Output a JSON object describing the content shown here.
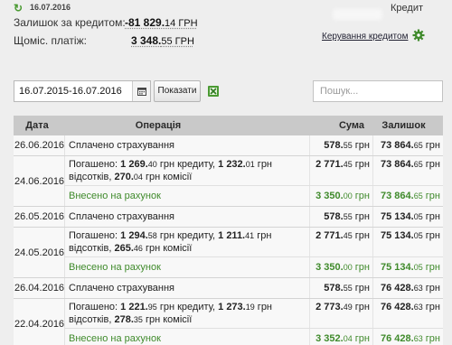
{
  "header": {
    "date": "16.07.2016",
    "product": "Кредит",
    "balance_label": "Залишок за кредитом:",
    "balance_value_main": "-81 829.",
    "balance_value_cents": "14 ГРН",
    "payment_label": "Щоміс. платіж:",
    "payment_value_main": "3 348.",
    "payment_value_cents": "55 ГРН",
    "manage_link": "Керування кредитом"
  },
  "toolbar": {
    "date_range": "16.07.2015-16.07.2016",
    "show_button": "Показати",
    "search_placeholder": "Пошук..."
  },
  "table": {
    "headers": {
      "date": "Дата",
      "operation": "Операція",
      "sum": "Сума",
      "balance": "Залишок"
    },
    "groups": [
      {
        "date": "26.06.2016",
        "rows": [
          {
            "type": "single",
            "op_text": "Сплачено страхування",
            "sum_main": "578.",
            "sum_cents": "55",
            "sum_unit": " грн",
            "bal_main": "73 864.",
            "bal_cents": "65",
            "bal_unit": " грн"
          }
        ]
      },
      {
        "date": "24.06.2016",
        "rows": [
          {
            "type": "payment",
            "op_prefix": "Погашено: ",
            "op_a_main": "1 269.",
            "op_a_cents": "40",
            "op_a_text": " грн кредиту, ",
            "op_b_main": "1 232.",
            "op_b_cents": "01",
            "op_b_text": " грн відсотків, ",
            "op_c_main": "270.",
            "op_c_cents": "04",
            "op_c_text": " грн комісії",
            "sum_main": "2 771.",
            "sum_cents": "45",
            "sum_unit": " грн",
            "bal_main": "73 864.",
            "bal_cents": "65",
            "bal_unit": " грн"
          },
          {
            "type": "green",
            "op_text": "Внесено на рахунок",
            "sum_main": "3 350.",
            "sum_cents": "00",
            "sum_unit": " грн",
            "bal_main": "73 864.",
            "bal_cents": "65",
            "bal_unit": " грн"
          }
        ]
      },
      {
        "date": "26.05.2016",
        "rows": [
          {
            "type": "single",
            "op_text": "Сплачено страхування",
            "sum_main": "578.",
            "sum_cents": "55",
            "sum_unit": " грн",
            "bal_main": "75 134.",
            "bal_cents": "05",
            "bal_unit": " грн"
          }
        ]
      },
      {
        "date": "24.05.2016",
        "rows": [
          {
            "type": "payment",
            "op_prefix": "Погашено: ",
            "op_a_main": "1 294.",
            "op_a_cents": "58",
            "op_a_text": " грн кредиту, ",
            "op_b_main": "1 211.",
            "op_b_cents": "41",
            "op_b_text": " грн відсотків, ",
            "op_c_main": "265.",
            "op_c_cents": "46",
            "op_c_text": " грн комісії",
            "sum_main": "2 771.",
            "sum_cents": "45",
            "sum_unit": " грн",
            "bal_main": "75 134.",
            "bal_cents": "05",
            "bal_unit": " грн"
          },
          {
            "type": "green",
            "op_text": "Внесено на рахунок",
            "sum_main": "3 350.",
            "sum_cents": "00",
            "sum_unit": " грн",
            "bal_main": "75 134.",
            "bal_cents": "05",
            "bal_unit": " грн"
          }
        ]
      },
      {
        "date": "26.04.2016",
        "rows": [
          {
            "type": "single",
            "op_text": "Сплачено страхування",
            "sum_main": "578.",
            "sum_cents": "55",
            "sum_unit": " грн",
            "bal_main": "76 428.",
            "bal_cents": "63",
            "bal_unit": " грн"
          }
        ]
      },
      {
        "date": "22.04.2016",
        "rows": [
          {
            "type": "payment",
            "op_prefix": "Погашено: ",
            "op_a_main": "1 221.",
            "op_a_cents": "95",
            "op_a_text": " грн кредиту, ",
            "op_b_main": "1 273.",
            "op_b_cents": "19",
            "op_b_text": " грн відсотків, ",
            "op_c_main": "278.",
            "op_c_cents": "35",
            "op_c_text": " грн комісії",
            "sum_main": "2 773.",
            "sum_cents": "49",
            "sum_unit": " грн",
            "bal_main": "76 428.",
            "bal_cents": "63",
            "bal_unit": " грн"
          },
          {
            "type": "green",
            "op_text": "Внесено на рахунок",
            "sum_main": "3 352.",
            "sum_cents": "04",
            "sum_unit": " грн",
            "bal_main": "76 428.",
            "bal_cents": "63",
            "bal_unit": " грн"
          }
        ]
      }
    ]
  },
  "icons": {
    "refresh": "refresh-icon",
    "gear": "gear-icon",
    "calendar": "calendar-icon",
    "excel": "excel-export-icon"
  },
  "colors": {
    "accent_green": "#3f8a2b",
    "header_row_bg": "#c9c9c9",
    "page_bg": "#eeeeee"
  }
}
